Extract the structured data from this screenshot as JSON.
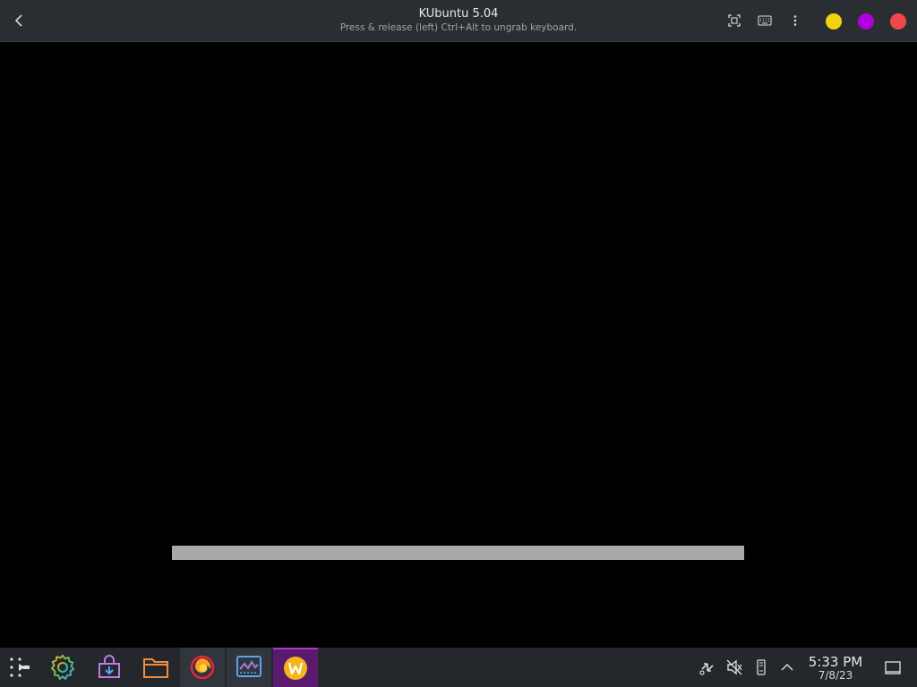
{
  "window": {
    "title": "KUbuntu 5.04",
    "subtitle": "Press & release (left) Ctrl+Alt to ungrab keyboard.",
    "buttons": {
      "back": "back-icon",
      "fullscreen": "fullscreen-icon",
      "keyboard": "keyboard-icon",
      "menu": "kebab-menu-icon",
      "minimize_color": "#f4d20c",
      "maximize_color": "#b100e0",
      "close_color": "#f2474a"
    }
  },
  "vm": {
    "background": "#000000",
    "progress_fill_fraction": 1.0,
    "progress_color": "#a9a9a9"
  },
  "taskbar": {
    "launcher": "application-launcher-icon",
    "apps": [
      {
        "name": "settings-icon",
        "state": "pinned"
      },
      {
        "name": "discover-store-icon",
        "state": "pinned"
      },
      {
        "name": "file-manager-icon",
        "state": "pinned"
      },
      {
        "name": "firefox-icon",
        "state": "running"
      },
      {
        "name": "system-monitor-icon",
        "state": "running"
      },
      {
        "name": "vm-window-icon",
        "state": "active"
      }
    ],
    "tray": [
      "network-icon",
      "volume-muted-icon",
      "storage-icon",
      "tray-expand-icon"
    ],
    "clock": {
      "time": "5:33 PM",
      "date": "7/8/23"
    },
    "show_desktop": "show-desktop-icon"
  }
}
